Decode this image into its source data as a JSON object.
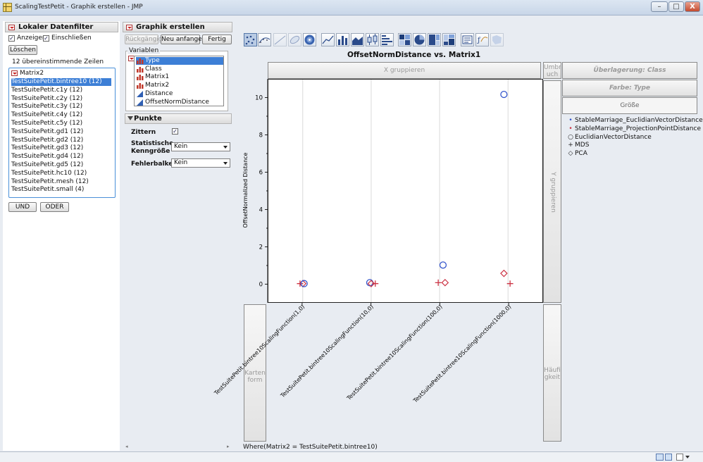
{
  "window": {
    "title": "ScalingTestPetit - Graphik erstellen - JMP",
    "minimize": "–",
    "maximize": "□",
    "close": "X"
  },
  "filter": {
    "header": "Lokaler Datenfilter",
    "show_label": "Anzeigen",
    "include_label": "Einschließen",
    "clear_button": "Löschen",
    "matching_rows": "12 übereinstimmende Zeilen",
    "column": "Matrix2",
    "items": [
      "TestSuitePetit.bintree10 (12)",
      "TestSuitePetit.c1y (12)",
      "TestSuitePetit.c2y (12)",
      "TestSuitePetit.c3y (12)",
      "TestSuitePetit.c4y (12)",
      "TestSuitePetit.c5y (12)",
      "TestSuitePetit.gd1 (12)",
      "TestSuitePetit.gd2 (12)",
      "TestSuitePetit.gd3 (12)",
      "TestSuitePetit.gd4 (12)",
      "TestSuitePetit.gd5 (12)",
      "TestSuitePetit.hc10 (12)",
      "TestSuitePetit.mesh (12)",
      "TestSuitePetit.small (4)"
    ],
    "and_button": "UND",
    "or_button": "ODER"
  },
  "builder": {
    "header": "Graphik erstellen",
    "undo_button": "Rückgängig",
    "restart_button": "Neu anfangen",
    "done_button": "Fertig",
    "variables_label": "Variablen",
    "variables": [
      "Type",
      "Class",
      "Matrix1",
      "Matrix2",
      "Distance",
      "OffsetNormDistance"
    ],
    "points_header": "Punkte",
    "jitter_label": "Zittern",
    "stat_label_1": "Statistische",
    "stat_label_2": "Kenngröße",
    "stat_value": "Kein",
    "error_label": "Fehlerbalken",
    "error_value": "Kein"
  },
  "zones": {
    "x_group": "X gruppieren",
    "wrap": [
      "Umbr",
      "uch"
    ],
    "y_group": "Y gruppieren",
    "overlay": "Überlagerung: Class",
    "color": "Farbe: Type",
    "size": "Größe",
    "map": [
      "Karten",
      "form"
    ],
    "freq": [
      "Häufi",
      "gkeit"
    ]
  },
  "legend": [
    {
      "label": "StableMarriage_EuclidianVectorDistance",
      "marker": "dot",
      "color": "#3355cc"
    },
    {
      "label": "StableMarriage_ProjectionPointDistance",
      "marker": "dot",
      "color": "#cc3344"
    },
    {
      "label": "EuclidianVectorDistance",
      "marker": "circle",
      "color": "#222222"
    },
    {
      "label": "MDS",
      "marker": "plus",
      "color": "#222222"
    },
    {
      "label": "PCA",
      "marker": "diamond",
      "color": "#222222"
    }
  ],
  "where_clause": "Where(Matrix2 = TestSuitePetit.bintree10)",
  "chart_data": {
    "type": "scatter",
    "title": "OffsetNormDistance vs. Matrix1",
    "xlabel": "",
    "ylabel": "OffsetNormalized Distance",
    "categories": [
      "TestSuitePetit.bintree10ScalingFunction(1,0)",
      "TestSuitePetit.bintree10ScalingFunction(10,0)",
      "TestSuitePetit.bintree10ScalingFunction(100,0)",
      "TestSuitePetit.bintree10ScalingFunction(1000,0)"
    ],
    "ylim": [
      -1,
      11
    ],
    "yticks": [
      0,
      2,
      4,
      6,
      8,
      10
    ],
    "grid": "vertical",
    "points": [
      {
        "category": 0,
        "y": 0,
        "marker": "plus",
        "color": "#cc3344",
        "offset": -0.04
      },
      {
        "category": 0,
        "y": 0,
        "marker": "diamond",
        "color": "#cc3344",
        "offset": 0.0
      },
      {
        "category": 0,
        "y": 0,
        "marker": "circle",
        "color": "#3355cc",
        "offset": 0.02
      },
      {
        "category": 1,
        "y": 0.05,
        "marker": "circle",
        "color": "#3355cc",
        "offset": -0.02
      },
      {
        "category": 1,
        "y": 0,
        "marker": "diamond",
        "color": "#cc3344",
        "offset": 0.0
      },
      {
        "category": 1,
        "y": 0,
        "marker": "plus",
        "color": "#cc3344",
        "offset": 0.06
      },
      {
        "category": 2,
        "y": 1,
        "marker": "circle",
        "color": "#3355cc",
        "offset": 0.05
      },
      {
        "category": 2,
        "y": 0.05,
        "marker": "plus",
        "color": "#cc3344",
        "offset": -0.02
      },
      {
        "category": 2,
        "y": 0.05,
        "marker": "diamond",
        "color": "#cc3344",
        "offset": 0.08
      },
      {
        "category": 3,
        "y": 10.2,
        "marker": "circle",
        "color": "#3355cc",
        "offset": -0.06
      },
      {
        "category": 3,
        "y": 0.55,
        "marker": "diamond",
        "color": "#cc3344",
        "offset": -0.06
      },
      {
        "category": 3,
        "y": 0,
        "marker": "plus",
        "color": "#cc3344",
        "offset": 0.03
      }
    ]
  }
}
